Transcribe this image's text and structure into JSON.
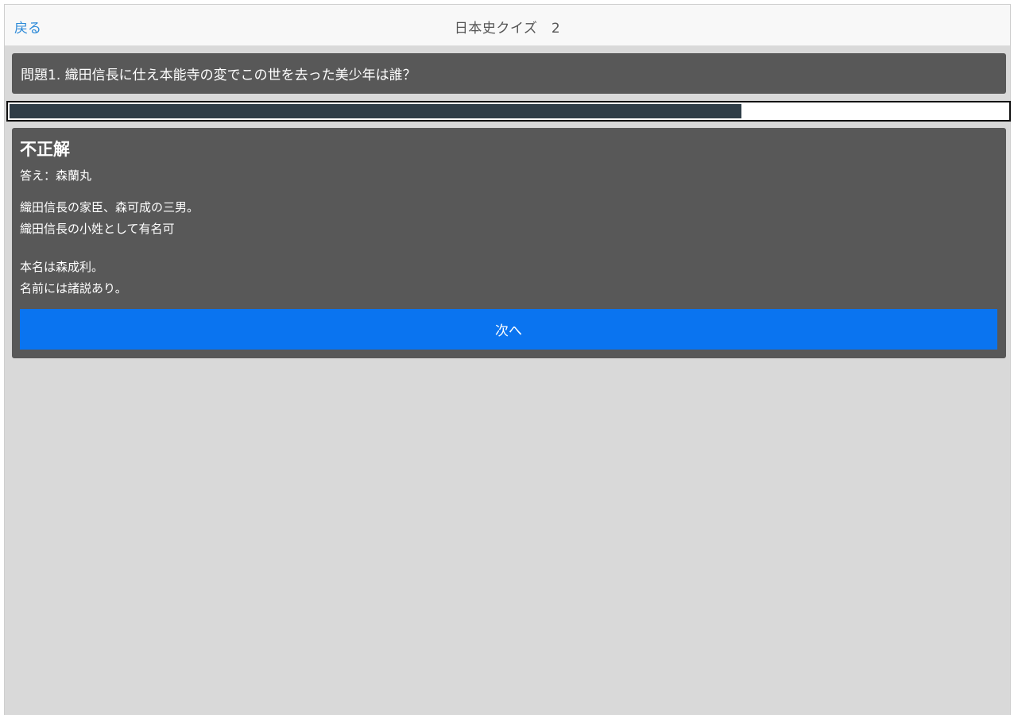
{
  "navbar": {
    "back_label": "戻る",
    "title": "日本史クイズ　2"
  },
  "question": {
    "text": "問題1. 織田信長に仕え本能寺の変でこの世を去った美少年は誰？"
  },
  "progress": {
    "fraction": 0.733,
    "fill_color": "#2f3d47"
  },
  "result": {
    "heading": "不正解",
    "answer": "答え：森蘭丸",
    "explanation": [
      [
        "織田信長の家臣、森可成の三男。",
        "織田信長の小姓として有名可"
      ],
      [
        "本名は森成利。",
        "名前には諸説あり。"
      ]
    ],
    "next_label": "次へ"
  },
  "colors": {
    "accent": "#0a74f0",
    "link": "#2d8ad8",
    "panel": "#585858",
    "background": "#d9d9d9"
  }
}
